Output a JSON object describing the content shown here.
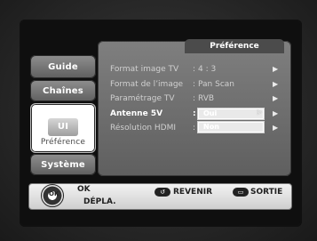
{
  "tabs": [
    {
      "label": "Guide"
    },
    {
      "label": "Chaînes"
    },
    {
      "label": "Préférence",
      "icon_text": "UI"
    },
    {
      "label": "Système"
    }
  ],
  "panel": {
    "title": "Préférence",
    "rows": [
      {
        "label": "Format image TV",
        "colon": ":",
        "value": "4 : 3"
      },
      {
        "label": "Format de l’image",
        "colon": ":",
        "value": "Pan Scan"
      },
      {
        "label": "Paramétrage TV",
        "colon": ":",
        "value": "RVB"
      },
      {
        "label": "Antenne 5V",
        "colon": ":",
        "value": ""
      },
      {
        "label": "Résolution HDMI",
        "colon": ":",
        "value": ""
      }
    ],
    "dropdown": {
      "options": [
        "Oui",
        "Non"
      ]
    }
  },
  "bottom": {
    "ok_label": "OK",
    "depla_label": "DÉPLA.",
    "revenir_label": "REVENIR",
    "sortie_label": "SORTIE"
  },
  "icons": {
    "arrow": "right-triangle-icon",
    "dpad": "dpad-icon",
    "back": "back-icon",
    "exit": "exit-icon"
  }
}
